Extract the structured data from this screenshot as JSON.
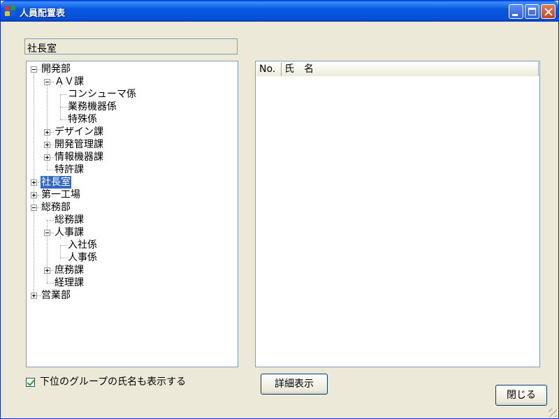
{
  "window": {
    "title": "人員配置表"
  },
  "path_box": {
    "value": "社長室"
  },
  "tree": {
    "nodes": [
      {
        "label": "開発部",
        "level": 0,
        "expander": "minus"
      },
      {
        "label": "ＡＶ課",
        "level": 1,
        "expander": "minus"
      },
      {
        "label": "コンシューマ係",
        "level": 2,
        "expander": "none"
      },
      {
        "label": "業務機器係",
        "level": 2,
        "expander": "none"
      },
      {
        "label": "特殊係",
        "level": 2,
        "expander": "none"
      },
      {
        "label": "デザイン課",
        "level": 1,
        "expander": "plus"
      },
      {
        "label": "開発管理課",
        "level": 1,
        "expander": "plus"
      },
      {
        "label": "情報機器課",
        "level": 1,
        "expander": "plus"
      },
      {
        "label": "特許課",
        "level": 1,
        "expander": "none"
      },
      {
        "label": "社長室",
        "level": 0,
        "expander": "plus",
        "selected": true
      },
      {
        "label": "第一工場",
        "level": 0,
        "expander": "plus"
      },
      {
        "label": "総務部",
        "level": 0,
        "expander": "minus"
      },
      {
        "label": "総務課",
        "level": 1,
        "expander": "none"
      },
      {
        "label": "人事課",
        "level": 1,
        "expander": "minus"
      },
      {
        "label": "入社係",
        "level": 2,
        "expander": "none"
      },
      {
        "label": "人事係",
        "level": 2,
        "expander": "none"
      },
      {
        "label": "庶務課",
        "level": 1,
        "expander": "plus"
      },
      {
        "label": "経理課",
        "level": 1,
        "expander": "none"
      },
      {
        "label": "営業部",
        "level": 0,
        "expander": "plus"
      }
    ]
  },
  "list": {
    "columns": [
      "No.",
      "氏　名"
    ]
  },
  "checkbox": {
    "label": "下位のグループの氏名も表示する",
    "checked": true
  },
  "buttons": {
    "detail": "詳細表示",
    "close": "閉じる"
  }
}
